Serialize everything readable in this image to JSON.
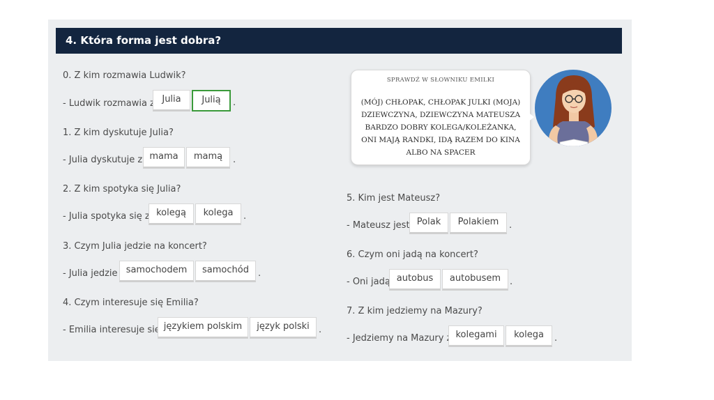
{
  "header": {
    "title": "4. Która forma jest dobra?"
  },
  "bubble": {
    "title": "SPRAWDŹ W SŁOWNIKU EMILKI",
    "lines": [
      "(MÓJ) CHŁOPAK, CHŁOPAK JULKI (MOJA)",
      "DZIEWCZYNA, DZIEWCZYNA MATEUSZA",
      "BARDZO DOBRY KOLEGA/KOLEŻANKA,",
      "ONI MAJĄ RANDKI, IDĄ RAZEM DO KINA",
      "ALBO NA SPACER"
    ]
  },
  "questions": [
    {
      "question": "0. Z kim rozmawia Ludwik?",
      "prefix": "- Ludwik rozmawia z",
      "options": [
        "Julia",
        "Julią"
      ],
      "selected": 1,
      "period": "."
    },
    {
      "question": "1. Z kim dyskutuje Julia?",
      "prefix": "- Julia dyskutuje z",
      "options": [
        "mama",
        "mamą"
      ],
      "period": "."
    },
    {
      "question": "2. Z kim spotyka się Julia?",
      "prefix": "- Julia spotyka się z",
      "options": [
        "kolegą",
        "kolega"
      ],
      "period": "."
    },
    {
      "question": "3. Czym Julia jedzie na koncert?",
      "prefix": "- Julia jedzie",
      "options": [
        "samochodem",
        "samochód"
      ],
      "period": "."
    },
    {
      "question": "4. Czym interesuje się Emilia?",
      "prefix": "- Emilia interesuje się",
      "options": [
        "językiem polskim",
        "język polski"
      ],
      "period": "."
    },
    {
      "question": "5. Kim jest Mateusz?",
      "prefix": "- Mateusz jest",
      "options": [
        "Polak",
        "Polakiem"
      ],
      "period": "."
    },
    {
      "question": "6. Czym oni jadą na koncert?",
      "prefix": "- Oni jadą",
      "options": [
        "autobus",
        "autobusem"
      ],
      "period": "."
    },
    {
      "question": "7. Z kim jedziemy na Mazury?",
      "prefix": "- Jedziemy na Mazury z",
      "options": [
        "kolegami",
        "kolega"
      ],
      "period": "."
    }
  ],
  "colors": {
    "header_bg": "#13253f",
    "selected_border": "#3a9a3a",
    "panel_bg": "#eceef0"
  }
}
